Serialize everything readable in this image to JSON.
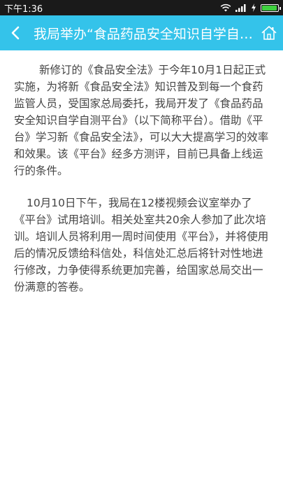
{
  "status_bar": {
    "time": "下午1:36",
    "battery_level": 0.95,
    "battery_color": "#3fd13f"
  },
  "app_bar": {
    "title": "我局举办“食品药品安全知识自学自测平台”试用培训",
    "background": "#34c3ea",
    "back_icon": "chevron-left-icon",
    "home_icon": "home-icon"
  },
  "article": {
    "paragraphs": [
      "新修订的《食品安全法》于今年10月1日起正式实施，为将新《食品安全法》知识普及到每一个食药监管人员，受国家总局委托，我局开发了《食品药品安全知识自学自测平台》（以下简称平台）。借助《平台》学习新《食品安全法》，可以大大提高学习的效率和效果。该《平台》经多方测评，目前已具备上线运行的条件。",
      "10月10日下午，我局在12楼视频会议室举办了《平台》试用培训。相关处室共20余人参加了此次培训。培训人员将利用一周时间使用《平台》，并将使用后的情况反馈给科信处，科信处汇总后将针对性地进行修改，力争使得系统更加完善，给国家总局交出一份满意的答卷。"
    ]
  }
}
